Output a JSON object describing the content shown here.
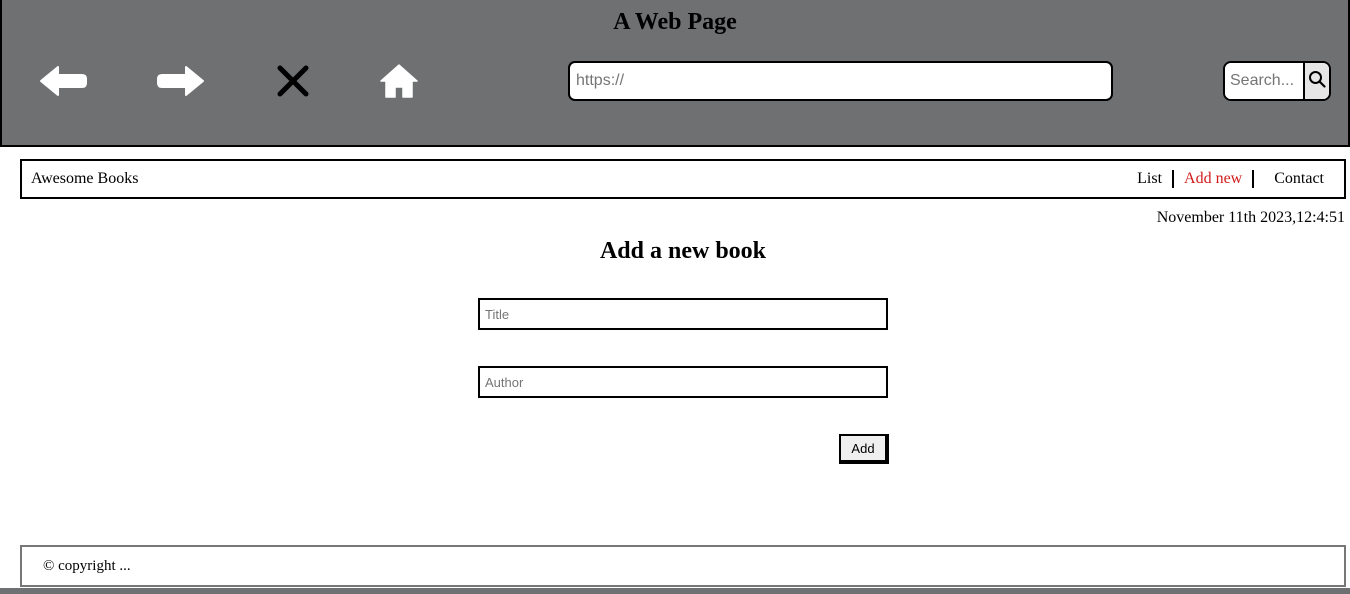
{
  "browser": {
    "title": "A Web Page",
    "url_placeholder": "https://",
    "search_placeholder": "Search...",
    "icons": [
      "back-arrow-icon",
      "forward-arrow-icon",
      "stop-icon",
      "home-icon",
      "magnifier-icon"
    ],
    "chrome_color": "#6f7072"
  },
  "site": {
    "brand": "Awesome Books",
    "nav": [
      {
        "label": "List",
        "active": false
      },
      {
        "label": "Add new",
        "active": true
      },
      {
        "label": "Contact",
        "active": false
      }
    ],
    "active_color": "#d11a1a",
    "datetime": "November 11th 2023,12:4:51"
  },
  "form": {
    "heading": "Add a new book",
    "title_placeholder": "Title",
    "author_placeholder": "Author",
    "submit_label": "Add"
  },
  "footer": {
    "text": "© copyright ..."
  }
}
